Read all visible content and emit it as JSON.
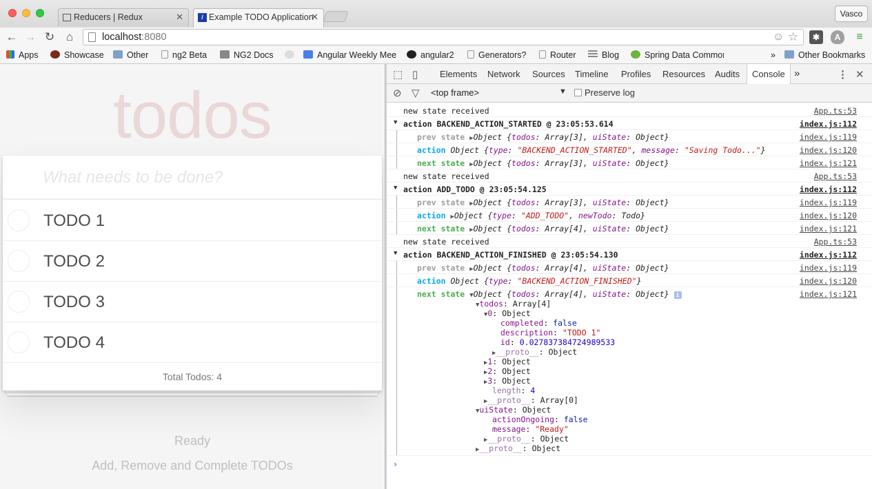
{
  "browser": {
    "tabs": [
      {
        "label": "Reducers | Redux",
        "icon": "book-icon"
      },
      {
        "label": "Example TODO Application",
        "icon": "angular-icon"
      }
    ],
    "user_button": "Vasco",
    "url_host": "localhost",
    "url_port": ":8080",
    "bookmarks": [
      {
        "label": "Apps"
      },
      {
        "label": "Showcase"
      },
      {
        "label": "Other"
      },
      {
        "label": "ng2 Beta"
      },
      {
        "label": "NG2 Docs"
      },
      {
        "label": ""
      },
      {
        "label": "Angular Weekly Meet"
      },
      {
        "label": "angular2"
      },
      {
        "label": "Generators?"
      },
      {
        "label": "Router"
      },
      {
        "label": "Blog"
      },
      {
        "label": "Spring Data Common"
      },
      {
        "label": "»"
      },
      {
        "label": "Other Bookmarks"
      }
    ]
  },
  "app": {
    "title": "todos",
    "new_todo_placeholder": "What needs to be done?",
    "todos": [
      "TODO 1",
      "TODO 2",
      "TODO 3",
      "TODO 4"
    ],
    "footer": "Total Todos: 4",
    "status": "Ready",
    "hint": "Add, Remove and Complete TODOs"
  },
  "devtools": {
    "tabs": [
      "Elements",
      "Network",
      "Sources",
      "Timeline",
      "Profiles",
      "Resources",
      "Audits",
      "Console"
    ],
    "more": "»",
    "frame": "<top frame>",
    "preserve_log": "Preserve log",
    "console": {
      "new_state": "new state received",
      "app_src": "App.ts:53",
      "src112": "index.js:112",
      "src119": "index.js:119",
      "src120": "index.js:120",
      "src121": "index.js:121",
      "group1_header": "action BACKEND_ACTION_STARTED @ 23:05:53.614",
      "group2_header": "action ADD_TODO @ 23:05:54.125",
      "group3_header": "action BACKEND_ACTION_FINISHED @ 23:05:54.130",
      "prev_label": "prev state",
      "action_label": "action",
      "next_label": "next state",
      "object_word": "Object",
      "state_todos3": "Array[3]",
      "state_todos4": "Array[4]",
      "ui_state_val": "Object",
      "action1_type": "\"BACKEND_ACTION_STARTED\"",
      "action1_msg": "\"Saving Todo...\"",
      "action2_type": "\"ADD_TODO\"",
      "action2_new": "Todo",
      "action3_type": "\"BACKEND_ACTION_FINISHED\"",
      "tree": {
        "todos_label": "todos",
        "todos_type": "Array[4]",
        "item0_label": "0",
        "item0_type": "Object",
        "completed": "false",
        "description": "\"TODO 1\"",
        "id": "0.027837384724989533",
        "proto": "__proto__",
        "proto_obj": "Object",
        "item1": "1",
        "item2": "2",
        "item3": "3",
        "length": "4",
        "proto_arr": "Array[0]",
        "ui_label": "uiState",
        "ui_type": "Object",
        "action_ongoing": "false",
        "message": "\"Ready\""
      }
    }
  }
}
